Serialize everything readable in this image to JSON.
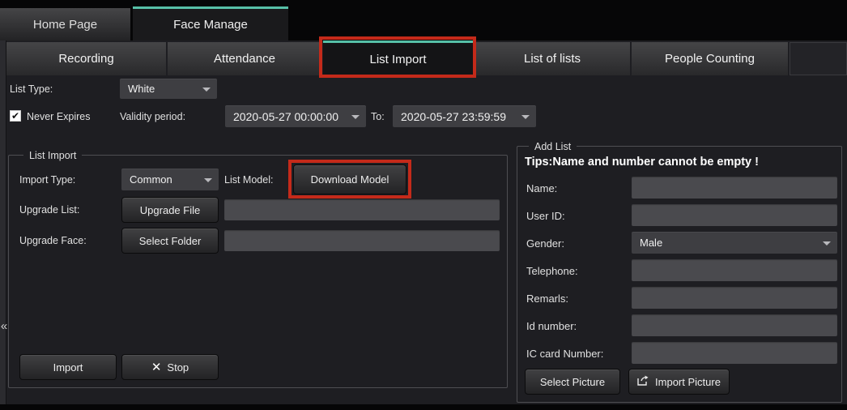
{
  "colors": {
    "accent_teal": "#57c0a7",
    "annotation_red": "#c42a1a"
  },
  "window_tabs": [
    {
      "label": "Home Page",
      "active": false
    },
    {
      "label": "Face Manage",
      "active": true
    }
  ],
  "sub_tabs": [
    {
      "label": "Recording",
      "active": false
    },
    {
      "label": "Attendance",
      "active": false
    },
    {
      "label": "List Import",
      "active": true,
      "highlighted": true
    },
    {
      "label": "List of lists",
      "active": false
    },
    {
      "label": "People Counting",
      "active": false
    }
  ],
  "collapse_icon": "«",
  "filters": {
    "list_type_label": "List Type:",
    "list_type_value": "White",
    "never_expires_checked": "✔",
    "never_expires_label": "Never Expires",
    "validity_label": "Validity period:",
    "validity_from": "2020-05-27 00:00:00",
    "to_label": "To:",
    "validity_to": "2020-05-27 23:59:59"
  },
  "list_import": {
    "legend": "List Import",
    "import_type_label": "Import Type:",
    "import_type_value": "Common",
    "list_model_label": "List Model:",
    "download_model_button": "Download Model",
    "upgrade_list_label": "Upgrade List:",
    "upgrade_file_button": "Upgrade File",
    "upgrade_list_value": "",
    "upgrade_face_label": "Upgrade Face:",
    "select_folder_button": "Select Folder",
    "upgrade_face_value": "",
    "import_button": "Import",
    "stop_icon": "✕",
    "stop_button": "Stop"
  },
  "add_list": {
    "legend": "Add List",
    "tips": "Tips:Name and number cannot be empty !",
    "fields": [
      {
        "label": "Name:",
        "type": "input",
        "value": ""
      },
      {
        "label": "User ID:",
        "type": "input",
        "value": ""
      },
      {
        "label": "Gender:",
        "type": "select",
        "value": "Male"
      },
      {
        "label": "Telephone:",
        "type": "input",
        "value": ""
      },
      {
        "label": "Remarls:",
        "type": "input",
        "value": ""
      },
      {
        "label": "Id number:",
        "type": "input",
        "value": ""
      },
      {
        "label": "IC card Number:",
        "type": "input",
        "value": ""
      }
    ],
    "select_picture_button": "Select Picture",
    "import_picture_button": "Import Picture"
  }
}
